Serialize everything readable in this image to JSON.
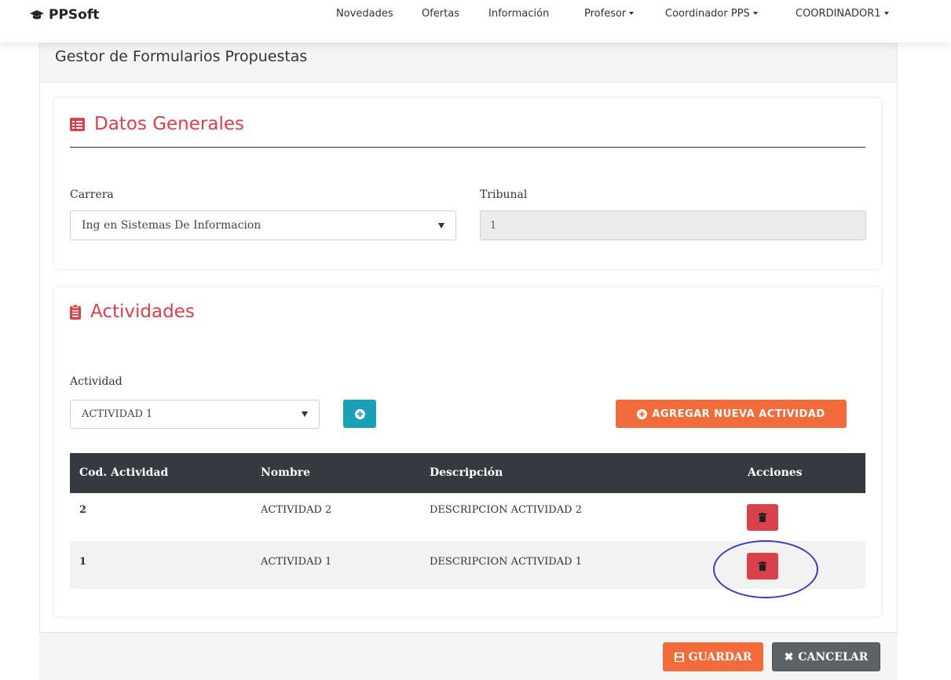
{
  "navbar": {
    "brand": "PPSoft",
    "brand_icon": "graduation-cap-icon",
    "items": [
      {
        "label": "Novedades"
      },
      {
        "label": "Ofertas"
      },
      {
        "label": "Información"
      },
      {
        "label": "Profesor",
        "dropdown": true
      },
      {
        "label": "Coordinador PPS",
        "dropdown": true
      },
      {
        "label": "COORDINADOR1",
        "dropdown": true
      }
    ]
  },
  "page": {
    "title": "Gestor de Formularios Propuestas"
  },
  "datos_generales": {
    "title": "Datos Generales",
    "icon": "list-alt-icon",
    "carrera_label": "Carrera",
    "carrera_value": "Ing en Sistemas De Informacion",
    "tribunal_label": "Tribunal",
    "tribunal_value": "1"
  },
  "actividades": {
    "title": "Actividades",
    "icon": "clipboard-icon",
    "actividad_label": "Actividad",
    "actividad_value": "ACTIVIDAD 1",
    "add_new_label": "AGREGAR NUEVA ACTIVIDAD",
    "table": {
      "headers": [
        "Cod. Actividad",
        "Nombre",
        "Descripción",
        "Acciones"
      ],
      "rows": [
        {
          "cod": "2",
          "nombre": "ACTIVIDAD 2",
          "descripcion": "DESCRIPCION ACTIVIDAD 2"
        },
        {
          "cod": "1",
          "nombre": "ACTIVIDAD 1",
          "descripcion": "DESCRIPCION ACTIVIDAD 1"
        }
      ]
    }
  },
  "footer": {
    "save_label": "GUARDAR",
    "cancel_label": "CANCELAR"
  },
  "colors": {
    "accent_red": "#d9414b",
    "orange": "#f26b3b",
    "teal": "#1aa1b8",
    "table_header": "#343a40",
    "annotation_circle": "#3a3ab8"
  }
}
